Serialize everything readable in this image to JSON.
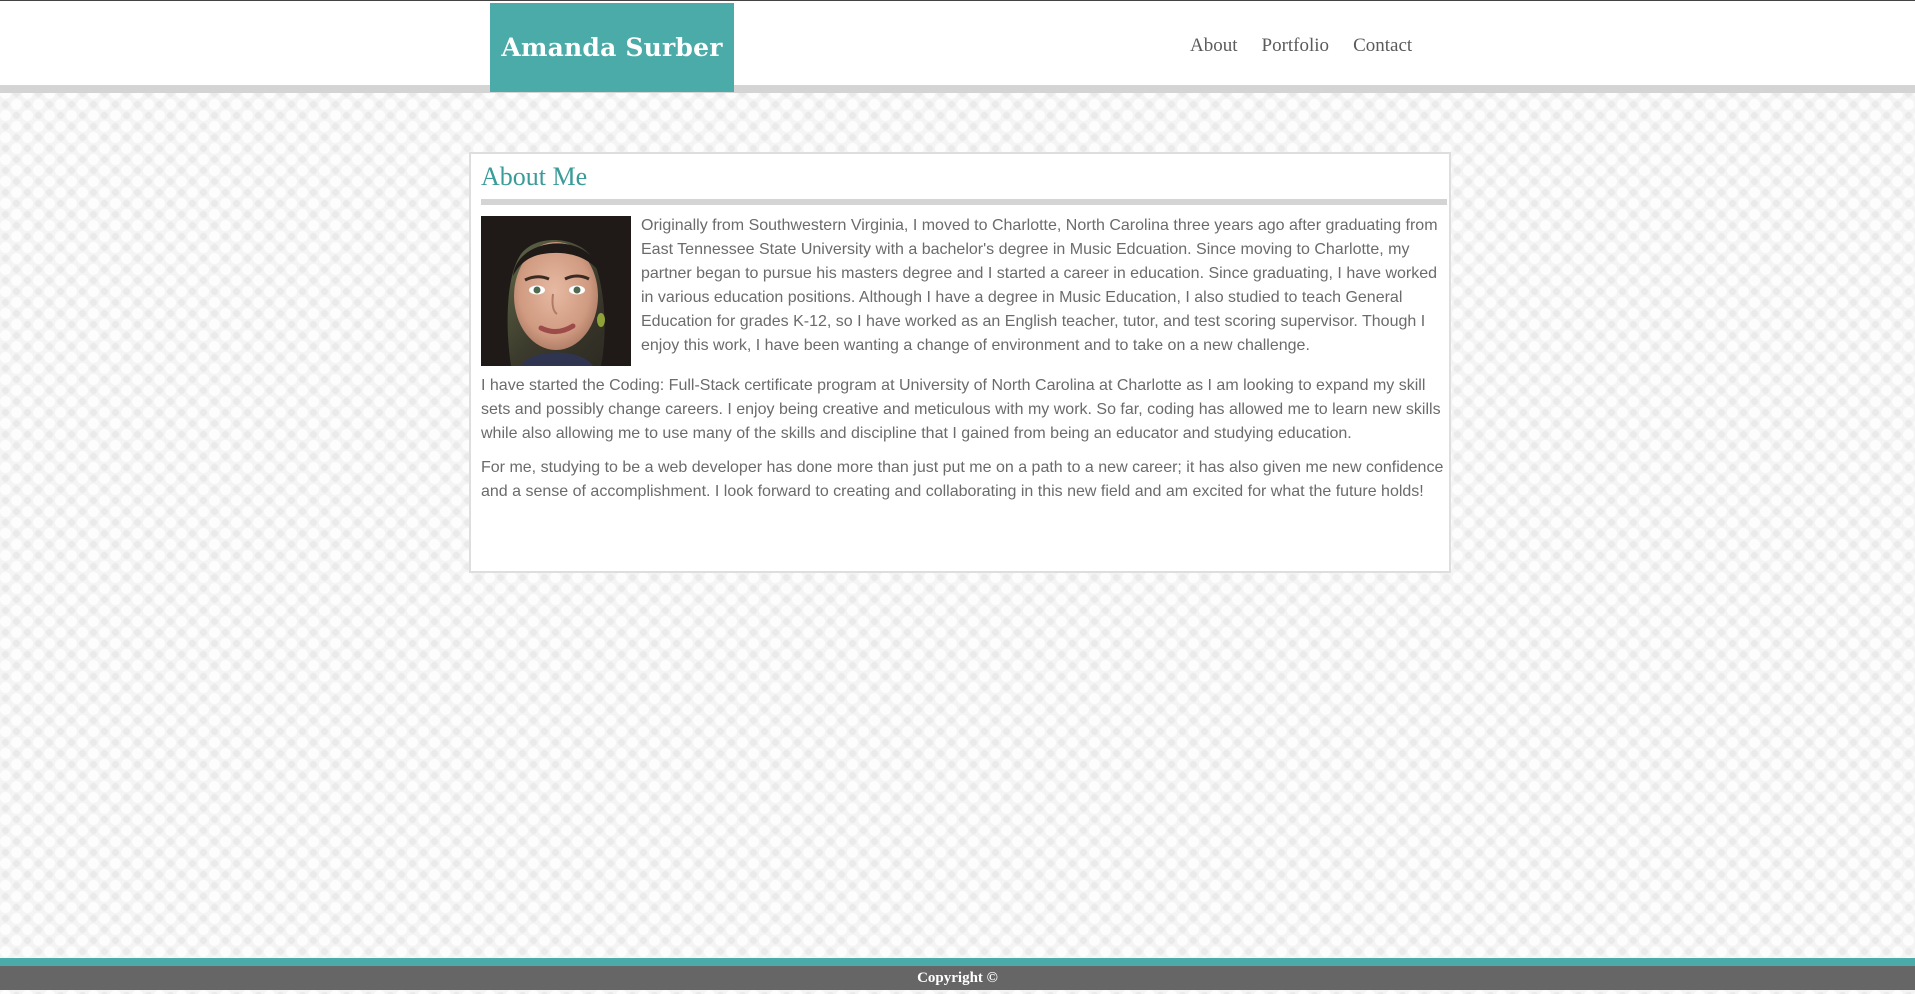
{
  "header": {
    "brand": "Amanda Surber",
    "nav": [
      {
        "label": "About"
      },
      {
        "label": "Portfolio"
      },
      {
        "label": "Contact"
      }
    ]
  },
  "colors": {
    "accent": "#4aaba8",
    "heading": "#3a9c99",
    "footer": "#666666",
    "body_text": "#6b6b6b"
  },
  "about": {
    "title": "About Me",
    "photo_icon": "profile-photo",
    "paragraphs": [
      "Originally from Southwestern Virginia, I moved to Charlotte, North Carolina three years ago after graduating from East Tennessee State University with a bachelor's degree in Music Edcuation. Since moving to Charlotte, my partner began to pursue his masters degree and I started a career in education. Since graduating, I have worked in various education positions. Although I have a degree in Music Education, I also studied to teach General Education for grades K-12, so I have worked as an English teacher, tutor, and test scoring supervisor. Though I enjoy this work, I have been wanting a change of environment and to take on a new challenge.",
      "I have started the Coding: Full-Stack certificate program at University of North Carolina at Charlotte as I am looking to expand my skill sets and possibly change careers. I enjoy being creative and meticulous with my work. So far, coding has allowed me to learn new skills while also allowing me to use many of the skills and discipline that I gained from being an educator and studying education.",
      "For me, studying to be a web developer has done more than just put me on a path to a new career; it has also given me new confidence and a sense of accomplishment. I look forward to creating and collaborating in this new field and am excited for what the future holds!"
    ]
  },
  "footer": {
    "copyright": "Copyright ©"
  }
}
